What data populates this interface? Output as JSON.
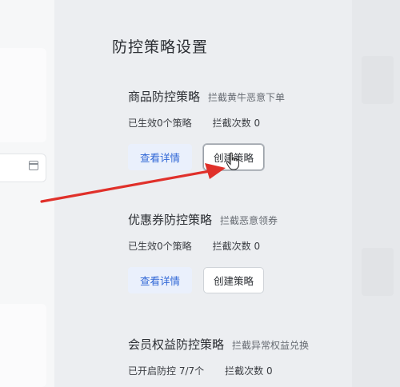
{
  "page": {
    "title": "防控策略设置"
  },
  "sections": [
    {
      "title": "商品防控策略",
      "desc": "拦截黄牛恶意下单",
      "stat1": "已生效0个策略",
      "stat2": "拦截次数 0",
      "view_label": "查看详情",
      "create_label": "创建策略"
    },
    {
      "title": "优惠券防控策略",
      "desc": "拦截恶意领券",
      "stat1": "已生效0个策略",
      "stat2": "拦截次数 0",
      "view_label": "查看详情",
      "create_label": "创建策略"
    },
    {
      "title": "会员权益防控策略",
      "desc": "拦截异常权益兑换",
      "stat1": "已开启防控 7/7个",
      "stat2": "拦截次数 0"
    }
  ],
  "icons": {
    "calendar": "calendar-icon",
    "cursor": "hand-cursor-icon"
  },
  "colors": {
    "accent": "#2f66d6",
    "arrow": "#e0302a"
  }
}
